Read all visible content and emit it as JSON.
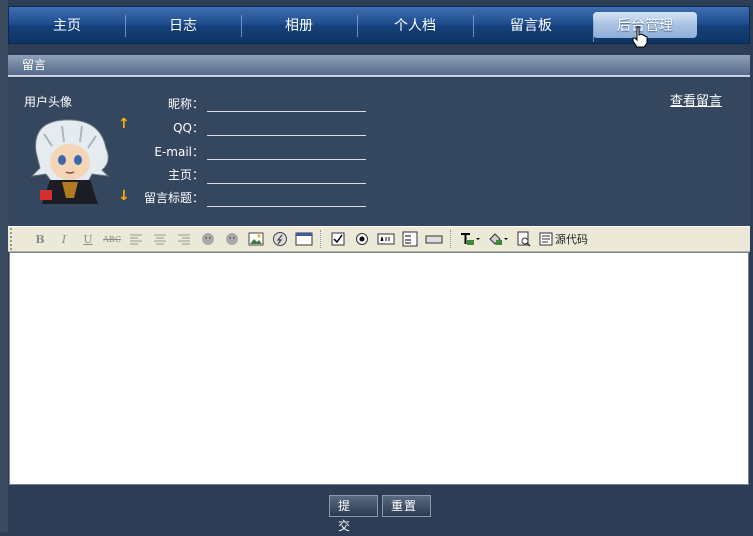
{
  "nav": {
    "items": [
      "主页",
      "日志",
      "相册",
      "个人档",
      "留言板"
    ],
    "active": "后台管理"
  },
  "section": {
    "title": "留言"
  },
  "form": {
    "avatar_label": "用户头像",
    "view_link": "查看留言",
    "fields": [
      {
        "label": "昵称："
      },
      {
        "label": "QQ："
      },
      {
        "label": "E-mail："
      },
      {
        "label": "主页："
      },
      {
        "label": "留言标题："
      }
    ]
  },
  "toolbar": {
    "bold": "B",
    "italic": "I",
    "underline": "U",
    "strike": "ABC",
    "source_label": "源代码"
  },
  "buttons": {
    "submit": "提 交",
    "reset": "重置"
  },
  "colors": {
    "nav": "#1f4f90",
    "panel": "#34475f",
    "toolbar": "#ece9d8"
  }
}
